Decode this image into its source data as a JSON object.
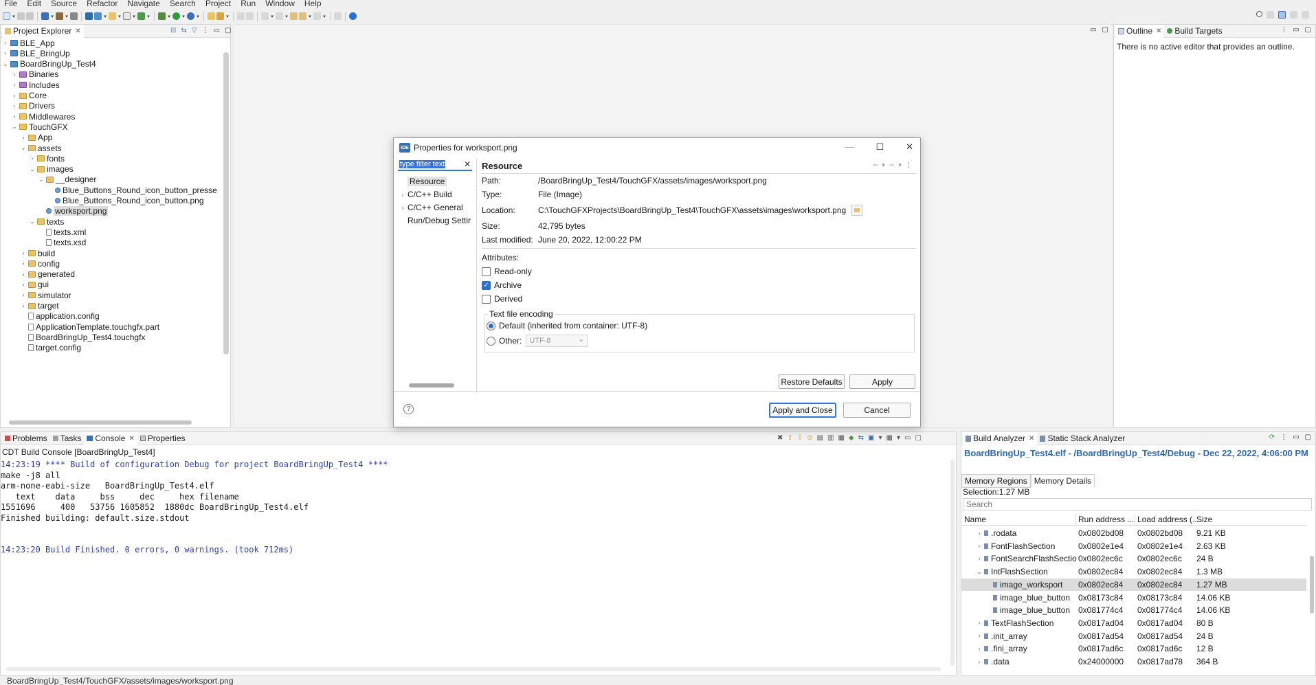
{
  "menu": [
    "File",
    "Edit",
    "Source",
    "Refactor",
    "Navigate",
    "Search",
    "Project",
    "Run",
    "Window",
    "Help"
  ],
  "project_explorer": {
    "tabs": [
      {
        "label": "Project Explorer",
        "active": true
      }
    ],
    "tree": [
      {
        "label": "BLE_App",
        "depth": 0,
        "kind": "proj",
        "twisty": "›"
      },
      {
        "label": "BLE_BringUp",
        "depth": 0,
        "kind": "proj",
        "twisty": "›"
      },
      {
        "label": "BoardBringUp_Test4",
        "depth": 0,
        "kind": "proj",
        "twisty": "⌄"
      },
      {
        "label": "Binaries",
        "depth": 1,
        "kind": "pkg",
        "twisty": "›"
      },
      {
        "label": "Includes",
        "depth": 1,
        "kind": "pkg",
        "twisty": "›"
      },
      {
        "label": "Core",
        "depth": 1,
        "kind": "folder",
        "twisty": "›"
      },
      {
        "label": "Drivers",
        "depth": 1,
        "kind": "folder",
        "twisty": "›"
      },
      {
        "label": "Middlewares",
        "depth": 1,
        "kind": "folder",
        "twisty": "›"
      },
      {
        "label": "TouchGFX",
        "depth": 1,
        "kind": "folder",
        "twisty": "⌄"
      },
      {
        "label": "App",
        "depth": 2,
        "kind": "folder",
        "twisty": "›"
      },
      {
        "label": "assets",
        "depth": 2,
        "kind": "folder",
        "twisty": "⌄"
      },
      {
        "label": "fonts",
        "depth": 3,
        "kind": "folder",
        "twisty": "›"
      },
      {
        "label": "images",
        "depth": 3,
        "kind": "folder",
        "twisty": "⌄"
      },
      {
        "label": "__designer",
        "depth": 4,
        "kind": "folder",
        "twisty": "⌄"
      },
      {
        "label": "Blue_Buttons_Round_icon_button_presse",
        "depth": 5,
        "kind": "img",
        "twisty": ""
      },
      {
        "label": "Blue_Buttons_Round_icon_button.png",
        "depth": 5,
        "kind": "img",
        "twisty": ""
      },
      {
        "label": "worksport.png",
        "depth": 4,
        "kind": "img",
        "twisty": "",
        "selected": true
      },
      {
        "label": "texts",
        "depth": 3,
        "kind": "folder",
        "twisty": "⌄"
      },
      {
        "label": "texts.xml",
        "depth": 4,
        "kind": "file",
        "twisty": ""
      },
      {
        "label": "texts.xsd",
        "depth": 4,
        "kind": "file",
        "twisty": ""
      },
      {
        "label": "build",
        "depth": 2,
        "kind": "folder",
        "twisty": "›"
      },
      {
        "label": "config",
        "depth": 2,
        "kind": "folder",
        "twisty": "›"
      },
      {
        "label": "generated",
        "depth": 2,
        "kind": "folder",
        "twisty": "›"
      },
      {
        "label": "gui",
        "depth": 2,
        "kind": "folder",
        "twisty": "›"
      },
      {
        "label": "simulator",
        "depth": 2,
        "kind": "folder",
        "twisty": "›"
      },
      {
        "label": "target",
        "depth": 2,
        "kind": "folder",
        "twisty": "›"
      },
      {
        "label": "application.config",
        "depth": 2,
        "kind": "file",
        "twisty": ""
      },
      {
        "label": "ApplicationTemplate.touchgfx.part",
        "depth": 2,
        "kind": "file",
        "twisty": ""
      },
      {
        "label": "BoardBringUp_Test4.touchgfx",
        "depth": 2,
        "kind": "file",
        "twisty": ""
      },
      {
        "label": "target.config",
        "depth": 2,
        "kind": "file",
        "twisty": ""
      }
    ]
  },
  "outline": {
    "tabs": [
      {
        "label": "Outline",
        "active": true
      },
      {
        "label": "Build Targets",
        "active": false
      }
    ],
    "message": "There is no active editor that provides an outline."
  },
  "dialog": {
    "title": "Properties for worksport.png",
    "icon_text": "IDE",
    "filter_placeholder": "type filter text",
    "nav": [
      {
        "label": "Resource",
        "twisty": "",
        "selected": true
      },
      {
        "label": "C/C++ Build",
        "twisty": "›"
      },
      {
        "label": "C/C++ General",
        "twisty": "›"
      },
      {
        "label": "Run/Debug Settir",
        "twisty": ""
      }
    ],
    "section_title": "Resource",
    "path_label": "Path:",
    "path_value": "/BoardBringUp_Test4/TouchGFX/assets/images/worksport.png",
    "type_label": "Type:",
    "type_value": "File  (Image)",
    "location_label": "Location:",
    "location_value": "C:\\TouchGFXProjects\\BoardBringUp_Test4\\TouchGFX\\assets\\images\\worksport.png",
    "size_label": "Size:",
    "size_value": "42,795  bytes",
    "modified_label": "Last modified:",
    "modified_value": "June 20, 2022, 12:00:22 PM",
    "attributes_label": "Attributes:",
    "readonly_label": "Read-only",
    "archive_label": "Archive",
    "derived_label": "Derived",
    "encoding_title": "Text file encoding",
    "default_encoding_label": "Default (inherited from container: UTF-8)",
    "other_label": "Other:",
    "other_value": "UTF-8",
    "restore_label": "Restore Defaults",
    "apply_label": "Apply",
    "apply_close_label": "Apply and Close",
    "cancel_label": "Cancel",
    "help_glyph": "?"
  },
  "console": {
    "tabs": [
      {
        "label": "Problems",
        "active": false
      },
      {
        "label": "Tasks",
        "active": false
      },
      {
        "label": "Console",
        "active": true
      },
      {
        "label": "Properties",
        "active": false
      }
    ],
    "header": "CDT Build Console [BoardBringUp_Test4]",
    "lines": [
      {
        "text": "14:23:19 **** Build of configuration Debug for project BoardBringUp_Test4 ****",
        "color": "blue"
      },
      {
        "text": "make -j8 all",
        "color": "black"
      },
      {
        "text": "arm-none-eabi-size   BoardBringUp_Test4.elf",
        "color": "black"
      },
      {
        "text": "   text    data     bss     dec     hex filename",
        "color": "black"
      },
      {
        "text": "1551696     400   53756 1605852  1880dc BoardBringUp_Test4.elf",
        "color": "black"
      },
      {
        "text": "Finished building: default.size.stdout",
        "color": "black"
      },
      {
        "text": "",
        "color": "black"
      },
      {
        "text": "",
        "color": "black"
      },
      {
        "text": "14:23:20 Build Finished. 0 errors, 0 warnings. (took 712ms)",
        "color": "blue"
      }
    ]
  },
  "build_analyzer": {
    "tabs": [
      {
        "label": "Build Analyzer",
        "active": true
      },
      {
        "label": "Static Stack Analyzer",
        "active": false
      }
    ],
    "title": "BoardBringUp_Test4.elf - /BoardBringUp_Test4/Debug - Dec 22, 2022, 4:06:00 PM",
    "subtabs": [
      {
        "label": "Memory Regions",
        "active": false
      },
      {
        "label": "Memory Details",
        "active": true
      }
    ],
    "selection": "Selection:1.27 MB",
    "search_placeholder": "Search",
    "columns": [
      "Name",
      "Run address ...",
      "Load address (...",
      "Size"
    ],
    "rows": [
      {
        "name": ".rodata",
        "depth": 1,
        "twisty": "›",
        "run": "0x0802bd08",
        "load": "0x0802bd08",
        "size": "9.21 KB"
      },
      {
        "name": "FontFlashSection",
        "depth": 1,
        "twisty": "›",
        "run": "0x0802e1e4",
        "load": "0x0802e1e4",
        "size": "2.63 KB"
      },
      {
        "name": "FontSearchFlashSectio",
        "depth": 1,
        "twisty": "›",
        "run": "0x0802ec6c",
        "load": "0x0802ec6c",
        "size": "24 B"
      },
      {
        "name": "IntFlashSection",
        "depth": 1,
        "twisty": "⌄",
        "run": "0x0802ec84",
        "load": "0x0802ec84",
        "size": "1.3 MB"
      },
      {
        "name": "image_worksport",
        "depth": 2,
        "twisty": "",
        "run": "0x0802ec84",
        "load": "0x0802ec84",
        "size": "1.27 MB",
        "selected": true
      },
      {
        "name": "image_blue_button",
        "depth": 2,
        "twisty": "",
        "run": "0x08173c84",
        "load": "0x08173c84",
        "size": "14.06 KB"
      },
      {
        "name": "image_blue_button",
        "depth": 2,
        "twisty": "",
        "run": "0x081774c4",
        "load": "0x081774c4",
        "size": "14.06 KB"
      },
      {
        "name": "TextFlashSection",
        "depth": 1,
        "twisty": "›",
        "run": "0x0817ad04",
        "load": "0x0817ad04",
        "size": "80 B"
      },
      {
        "name": ".init_array",
        "depth": 1,
        "twisty": "›",
        "run": "0x0817ad54",
        "load": "0x0817ad54",
        "size": "24 B"
      },
      {
        "name": ".fini_array",
        "depth": 1,
        "twisty": "›",
        "run": "0x0817ad6c",
        "load": "0x0817ad6c",
        "size": "12 B"
      },
      {
        "name": ".data",
        "depth": 1,
        "twisty": "›",
        "run": "0x24000000",
        "load": "0x0817ad78",
        "size": "364 B"
      }
    ]
  },
  "status_bar": "BoardBringUp_Test4/TouchGFX/assets/images/worksport.png",
  "colors": {
    "accent": "#3874d8",
    "link_blue": "#2b68b5",
    "console_blue": "#2b3fc4",
    "folder": "#e8c36a"
  }
}
